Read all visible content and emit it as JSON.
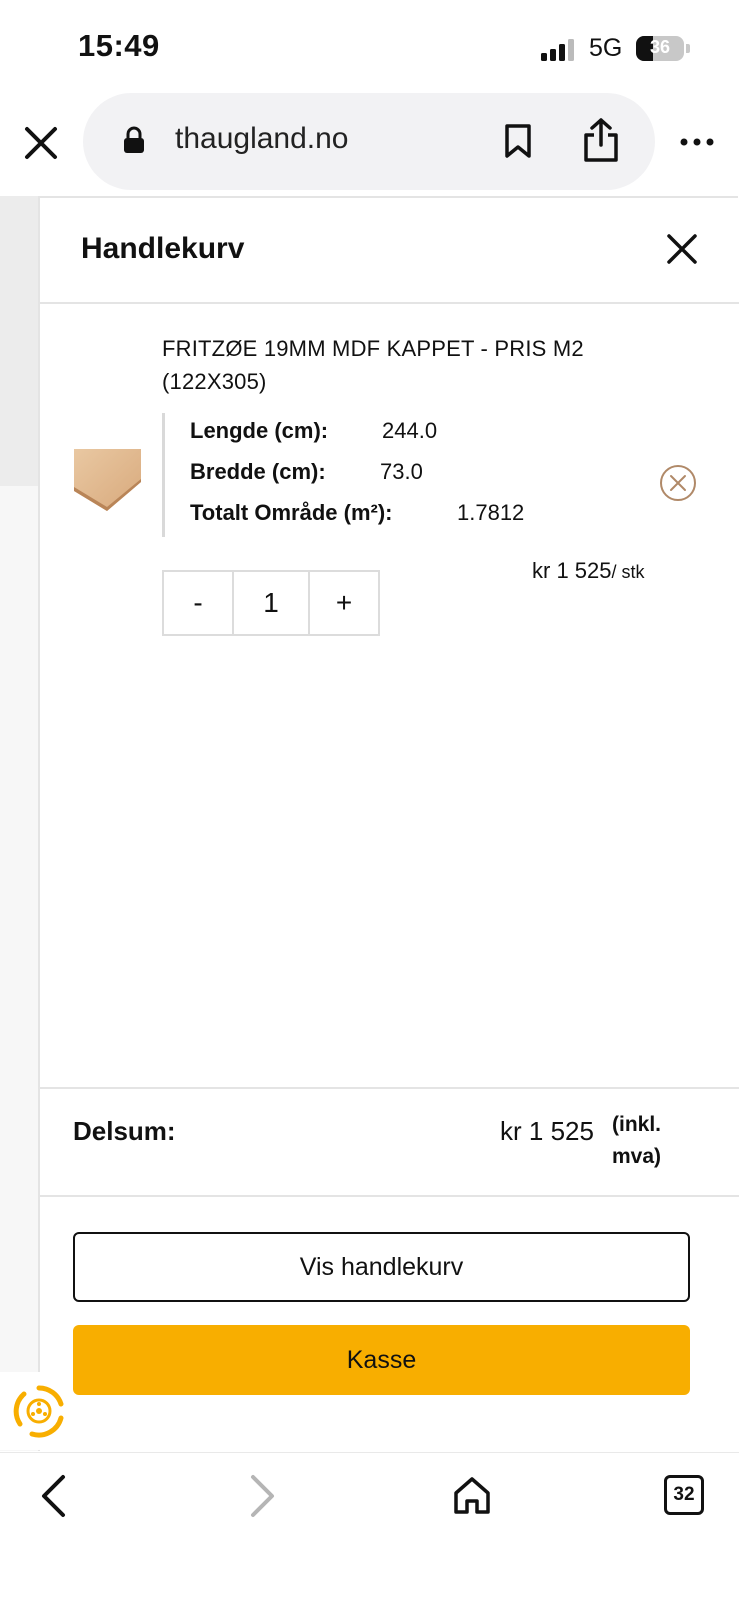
{
  "status_bar": {
    "time": "15:49",
    "network": "5G",
    "battery": "36",
    "battery_level": 0.36
  },
  "browser": {
    "url": "thaugland.no"
  },
  "cart": {
    "title": "Handlekurv",
    "item": {
      "name": "FRITZØE 19MM MDF KAPPET - PRIS M2 (122X305)",
      "attributes": [
        {
          "label": "Lengde (cm):",
          "value": "244.0"
        },
        {
          "label": "Bredde (cm):",
          "value": "73.0"
        },
        {
          "label": "Totalt Område (m²):",
          "value": "1.7812"
        }
      ],
      "quantity": "1",
      "minus_label": "-",
      "plus_label": "+",
      "price": "kr 1 525",
      "price_unit": "/ stk"
    },
    "subtotal": {
      "label": "Delsum:",
      "value": "kr 1 525",
      "vat_note": "(inkl. mva)"
    },
    "view_cart_label": "Vis handlekurv",
    "checkout_label": "Kasse",
    "accent_color": "#f8ae00"
  },
  "toolbar": {
    "tab_count": "32"
  }
}
